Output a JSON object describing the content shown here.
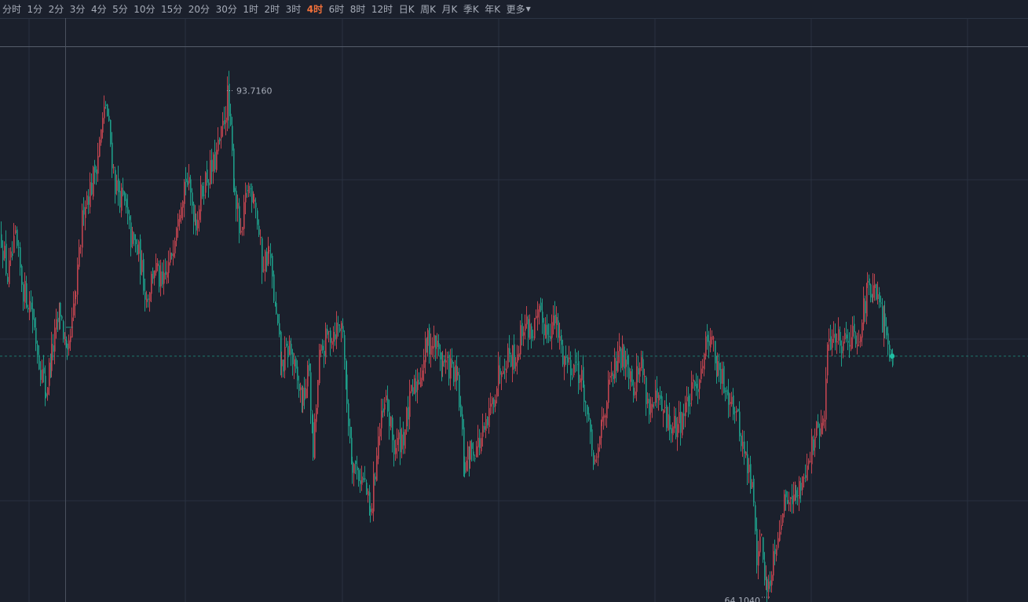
{
  "toolbar": {
    "periods": [
      "分时",
      "1分",
      "2分",
      "3分",
      "4分",
      "5分",
      "10分",
      "15分",
      "20分",
      "30分",
      "1时",
      "2时",
      "3时",
      "4时",
      "6时",
      "8时",
      "12时",
      "日K",
      "周K",
      "月K",
      "季K",
      "年K"
    ],
    "active_period": "4时",
    "more_label": "更多"
  },
  "colors": {
    "background": "#1b202c",
    "up": "#c0444f",
    "down": "#1e9c88",
    "grid": "#2a3140",
    "active": "#f0703a",
    "text": "#a6acb8"
  },
  "chart_data": {
    "type": "candlestick",
    "title": "",
    "xlabel": "",
    "ylabel": "",
    "grid": true,
    "ylim": [
      63.8,
      96.3
    ],
    "max_label": "93.7160",
    "min_label": "64.1040",
    "last_value": 78.2,
    "legs": [
      [
        0,
        85.2
      ],
      [
        8,
        82.8
      ],
      [
        18,
        84.9
      ],
      [
        28,
        82.1
      ],
      [
        38,
        81.1
      ],
      [
        48,
        78.0
      ],
      [
        57,
        76.1
      ],
      [
        64,
        78.3
      ],
      [
        75,
        80.9
      ],
      [
        84,
        77.8
      ],
      [
        95,
        81.8
      ],
      [
        105,
        87.2
      ],
      [
        115,
        88.2
      ],
      [
        123,
        90.1
      ],
      [
        133,
        93.0
      ],
      [
        145,
        88.3
      ],
      [
        157,
        87.0
      ],
      [
        165,
        85.1
      ],
      [
        175,
        84.2
      ],
      [
        185,
        81.6
      ],
      [
        195,
        83.5
      ],
      [
        205,
        82.1
      ],
      [
        215,
        83.7
      ],
      [
        225,
        86.9
      ],
      [
        235,
        88.7
      ],
      [
        248,
        86.2
      ],
      [
        258,
        88.4
      ],
      [
        270,
        89.3
      ],
      [
        280,
        91.0
      ],
      [
        288,
        93.4
      ],
      [
        297,
        88.1
      ],
      [
        305,
        84.8
      ],
      [
        313,
        88.1
      ],
      [
        322,
        87.8
      ],
      [
        332,
        83.6
      ],
      [
        341,
        84.3
      ],
      [
        350,
        80.4
      ],
      [
        357,
        77.6
      ],
      [
        367,
        78.8
      ],
      [
        375,
        76.9
      ],
      [
        384,
        75.6
      ],
      [
        392,
        77.5
      ],
      [
        397,
        72.5
      ],
      [
        405,
        78.0
      ],
      [
        415,
        79.3
      ],
      [
        425,
        79.8
      ],
      [
        435,
        80.0
      ],
      [
        440,
        75.5
      ],
      [
        447,
        72.1
      ],
      [
        455,
        71.3
      ],
      [
        463,
        70.7
      ],
      [
        470,
        68.7
      ],
      [
        480,
        73.5
      ],
      [
        490,
        75.5
      ],
      [
        500,
        72.8
      ],
      [
        512,
        73.6
      ],
      [
        522,
        75.8
      ],
      [
        532,
        77.0
      ],
      [
        543,
        79.1
      ],
      [
        553,
        78.9
      ],
      [
        562,
        77.8
      ],
      [
        572,
        77.5
      ],
      [
        581,
        76.6
      ],
      [
        590,
        71.7
      ],
      [
        597,
        72.7
      ],
      [
        607,
        73.0
      ],
      [
        617,
        73.8
      ],
      [
        627,
        75.9
      ],
      [
        637,
        77.9
      ],
      [
        647,
        78.4
      ],
      [
        655,
        78.1
      ],
      [
        665,
        80.2
      ],
      [
        675,
        79.6
      ],
      [
        685,
        80.4
      ],
      [
        695,
        79.8
      ],
      [
        705,
        80.2
      ],
      [
        715,
        78.3
      ],
      [
        725,
        77.7
      ],
      [
        733,
        77.7
      ],
      [
        742,
        76.2
      ],
      [
        750,
        73.0
      ],
      [
        758,
        71.6
      ],
      [
        765,
        74.6
      ],
      [
        775,
        76.5
      ],
      [
        785,
        78.0
      ],
      [
        795,
        78.3
      ],
      [
        805,
        76.6
      ],
      [
        815,
        77.8
      ],
      [
        825,
        75.1
      ],
      [
        835,
        75.5
      ],
      [
        845,
        74.6
      ],
      [
        855,
        73.8
      ],
      [
        865,
        74.5
      ],
      [
        875,
        75.6
      ],
      [
        885,
        76.4
      ],
      [
        895,
        78.5
      ],
      [
        903,
        79.8
      ],
      [
        912,
        77.2
      ],
      [
        920,
        76.6
      ],
      [
        930,
        75.8
      ],
      [
        940,
        73.9
      ],
      [
        948,
        72.1
      ],
      [
        956,
        70.5
      ],
      [
        962,
        66.6
      ],
      [
        968,
        67.5
      ],
      [
        975,
        64.3
      ],
      [
        985,
        67.1
      ],
      [
        995,
        69.3
      ],
      [
        1005,
        70.5
      ],
      [
        1012,
        69.8
      ],
      [
        1020,
        71.1
      ],
      [
        1028,
        72.3
      ],
      [
        1038,
        73.6
      ],
      [
        1048,
        74.3
      ],
      [
        1052,
        78.8
      ],
      [
        1060,
        79.5
      ],
      [
        1070,
        79.1
      ],
      [
        1080,
        79.5
      ],
      [
        1090,
        79.4
      ],
      [
        1098,
        80.8
      ],
      [
        1103,
        82.0
      ],
      [
        1110,
        81.8
      ],
      [
        1118,
        81.2
      ],
      [
        1125,
        79.5
      ],
      [
        1131,
        79.2
      ],
      [
        1136,
        78.2
      ]
    ]
  }
}
